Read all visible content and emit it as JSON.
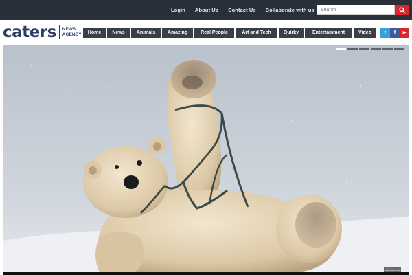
{
  "top_nav": [
    "Login",
    "About Us",
    "Contact Us",
    "Collaborate with us"
  ],
  "search": {
    "placeholder": "Search"
  },
  "logo": {
    "word": "caters",
    "line1": "NEWS",
    "line2": "AGENCY"
  },
  "main_nav": [
    "Home",
    "News",
    "Animals",
    "Amazing",
    "Real People",
    "Art and Tech",
    "Quirky",
    "Entertainment",
    "Video"
  ],
  "social": [
    {
      "name": "twitter",
      "glyph": "t",
      "color": "#3aa0d9"
    },
    {
      "name": "facebook",
      "glyph": "f",
      "color": "#3b5b9a"
    },
    {
      "name": "youtube",
      "glyph": "▶",
      "color": "#d9272e"
    }
  ],
  "slider": {
    "slide_count": 6,
    "active_index": 0
  },
  "hero": {
    "credit": "caters news"
  },
  "colors": {
    "topbar": "#2a3039",
    "accent_red": "#d9272e",
    "nav_bg": "#3a3e45",
    "logo_blue": "#2c3d66"
  }
}
